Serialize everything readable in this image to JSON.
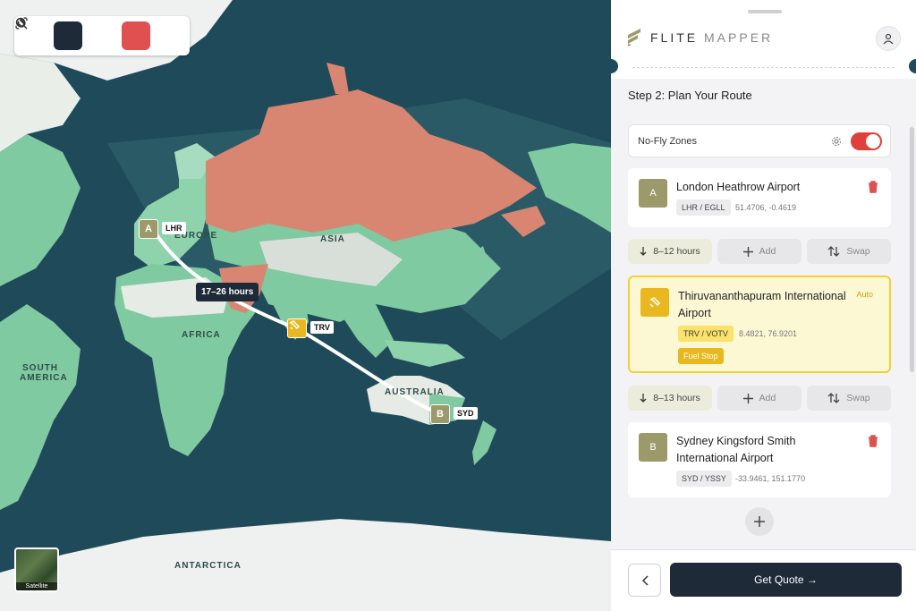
{
  "map": {
    "toolbar": [
      {
        "icon": "route-icon",
        "active": false
      },
      {
        "icon": "map-pin-icon",
        "active": true
      },
      {
        "icon": "globe-icon",
        "active": false
      },
      {
        "icon": "no-fly-icon",
        "active": true
      },
      {
        "icon": "search-icon",
        "active": false
      }
    ],
    "labels": {
      "europe": "EUROPE",
      "asia": "ASIA",
      "africa": "AFRICA",
      "south_america": "SOUTH\nAMERICA",
      "australia": "AUSTRALIA",
      "antarctica": "ANTARCTICA"
    },
    "origin": {
      "badge": "A",
      "code": "LHR"
    },
    "stop": {
      "code": "TRV"
    },
    "destination": {
      "badge": "B",
      "code": "SYD"
    },
    "leg1_duration": "17–26 hours",
    "satellite_label": "Satellite",
    "colors": {
      "ocean": "#1f4a5a",
      "land": "#7fcaa0",
      "nofly": "#d88672",
      "route": "#ffffff"
    }
  },
  "panel": {
    "brand": {
      "flite": "FLITE",
      "mapper": "MAPPER"
    },
    "step_title": "Step 2: Plan Your Route",
    "nofly_label": "No-Fly Zones",
    "nofly_enabled": true,
    "origin": {
      "badge": "A",
      "name": "London Heathrow Airport",
      "codes": "LHR / EGLL",
      "coords": "51.4706, -0.4619"
    },
    "leg1": {
      "duration": "8–12 hours",
      "add": "Add",
      "swap": "Swap"
    },
    "stop": {
      "name": "Thiruvananthapuram International Airport",
      "auto": "Auto",
      "codes": "TRV / VOTV",
      "coords": "8.4821, 76.9201",
      "tag": "Fuel Stop"
    },
    "leg2": {
      "duration": "8–13 hours",
      "add": "Add",
      "swap": "Swap"
    },
    "destination": {
      "badge": "B",
      "name": "Sydney Kingsford Smith International Airport",
      "codes": "SYD / YSSY",
      "coords": "-33.9461, 151.1770"
    },
    "quote_button": "Get Quote →"
  }
}
